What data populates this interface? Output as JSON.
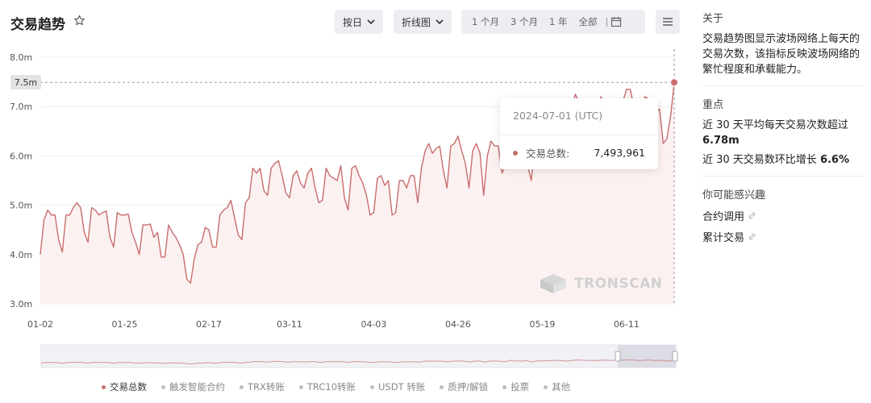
{
  "header": {
    "title": "交易趋势",
    "granularity": "按日",
    "chart_type": "折线图",
    "ranges": [
      "1 个月",
      "3 个月",
      "1 年",
      "全部"
    ]
  },
  "tooltip": {
    "date": "2024-07-01 (UTC)",
    "label": "交易总数:",
    "value": "7,493,961"
  },
  "marker_label": "7.5m",
  "watermark": "TRONSCAN",
  "legend": [
    "交易总数",
    "触发智能合约",
    "TRX转账",
    "TRC10转账",
    "USDT 转账",
    "质押/解锁",
    "投票",
    "其他"
  ],
  "sidebar": {
    "about_title": "关于",
    "about_text": "交易趋势图显示波场网络上每天的交易次数，该指标反映波场网络的繁忙程度和承载能力。",
    "key_title": "重点",
    "stat1_prefix": "近 30 天平均每天交易次数超过 ",
    "stat1_value": "6.78m",
    "stat2_prefix": "近 30 天交易数环比增长 ",
    "stat2_value": "6.6%",
    "interest_title": "你可能感兴趣",
    "links": [
      "合约调用",
      "累计交易"
    ]
  },
  "colors": {
    "line": "#c96d6d",
    "fill": "#fbeeee",
    "accent_dot": "#c96d6d"
  },
  "chart_data": {
    "type": "line",
    "title": "",
    "series": [
      {
        "name": "交易总数",
        "values": [
          4.0,
          4.7,
          4.9,
          4.8,
          4.8,
          4.3,
          4.05,
          4.8,
          4.8,
          4.95,
          5.05,
          4.95,
          4.45,
          4.25,
          4.95,
          4.9,
          4.8,
          4.85,
          4.88,
          4.35,
          4.15,
          4.85,
          4.8,
          4.8,
          4.82,
          4.45,
          4.25,
          4.0,
          4.6,
          4.6,
          4.62,
          4.35,
          4.45,
          3.95,
          3.95,
          4.6,
          4.45,
          4.35,
          4.2,
          4.0,
          3.5,
          3.42,
          3.9,
          4.2,
          4.25,
          4.55,
          4.5,
          4.15,
          4.15,
          4.8,
          4.9,
          4.95,
          5.1,
          4.75,
          4.4,
          4.3,
          5.05,
          5.15,
          5.75,
          5.65,
          5.75,
          5.3,
          5.2,
          5.75,
          5.85,
          5.9,
          5.6,
          5.25,
          5.15,
          5.6,
          5.7,
          5.45,
          5.35,
          5.65,
          5.75,
          5.35,
          5.05,
          5.1,
          5.75,
          5.6,
          5.55,
          5.5,
          5.8,
          5.15,
          4.9,
          5.75,
          5.8,
          5.6,
          5.45,
          5.2,
          4.8,
          4.85,
          5.55,
          5.6,
          5.4,
          5.5,
          4.8,
          4.85,
          5.5,
          5.5,
          5.35,
          5.6,
          5.6,
          5.05,
          5.75,
          6.1,
          6.25,
          6.05,
          6.15,
          6.2,
          5.7,
          5.35,
          6.2,
          6.25,
          6.4,
          6.1,
          5.85,
          5.35,
          6.1,
          6.25,
          6.05,
          5.2,
          6.0,
          6.3,
          6.2,
          6.2,
          5.65,
          5.8,
          7.05,
          6.1,
          6.3,
          6.1,
          6.8,
          5.8,
          5.5,
          6.3,
          6.4,
          6.4,
          6.5,
          6.7,
          6.8,
          6.95,
          6.6,
          6.25,
          6.3,
          6.9,
          7.25,
          7.1,
          6.9,
          7.0,
          6.8,
          6.85,
          6.8,
          7.2,
          7.05,
          6.9,
          7.0,
          6.95,
          7.1,
          7.1,
          7.35,
          7.35,
          7.0,
          6.7,
          6.9,
          7.2,
          7.15,
          6.7,
          6.9,
          6.95,
          6.25,
          6.35,
          6.8,
          7.49
        ]
      }
    ],
    "x_ticks": [
      "01-02",
      "01-25",
      "02-17",
      "03-11",
      "04-03",
      "04-26",
      "05-19",
      "06-11"
    ],
    "y_ticks": [
      "3.0m",
      "4.0m",
      "5.0m",
      "6.0m",
      "7.0m",
      "8.0m"
    ],
    "ylim": [
      3.0,
      8.0
    ],
    "grid": true,
    "highlight": {
      "x": "2024-07-01",
      "y": 7.49
    }
  }
}
